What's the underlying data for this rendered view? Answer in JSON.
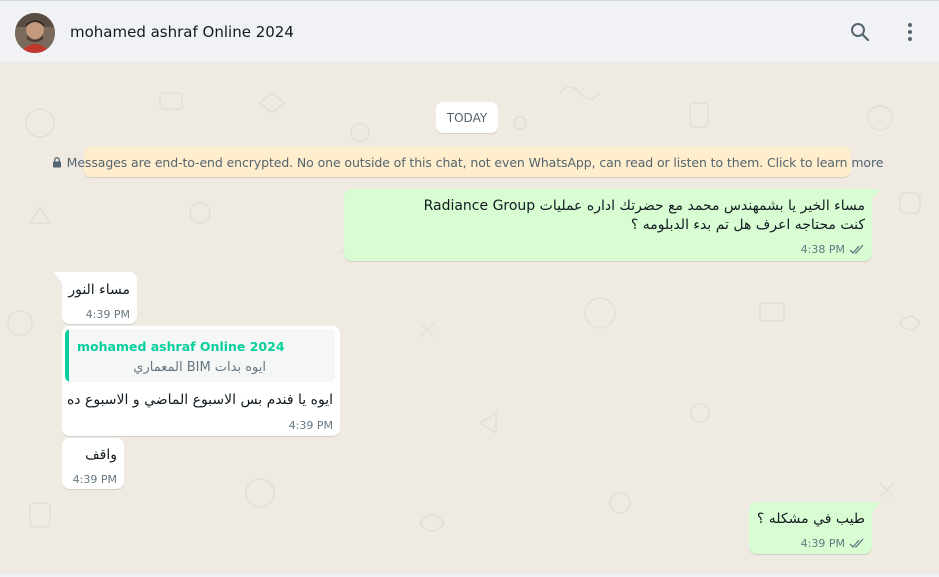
{
  "header": {
    "contact_name": "mohamed ashraf Online 2024",
    "search_icon": "search-icon",
    "menu_icon": "more-vertical-icon"
  },
  "date_chip": "TODAY",
  "encryption_notice": {
    "text": "Messages are end-to-end encrypted. No one outside of this chat, not even WhatsApp, can read or listen to them. Click to learn more",
    "icon": "lock-icon"
  },
  "messages": [
    {
      "direction": "outgoing",
      "lines": [
        "مساء الخير يا بشمهندس محمد مع حضرتك اداره عمليات Radiance Group",
        "كنت محتاجه اعرف هل تم بدء الدبلومه ؟"
      ],
      "time": "4:38 PM",
      "status": "read"
    },
    {
      "direction": "incoming",
      "lines": [
        "مساء النور"
      ],
      "time": "4:39 PM"
    },
    {
      "direction": "incoming",
      "quote": {
        "author": "mohamed ashraf Online 2024",
        "text": "ايوه بدات BIM  المعماري"
      },
      "lines": [
        "ايوه يا فندم بس الاسبوع الماضي و الاسبوع ده"
      ],
      "time": "4:39 PM"
    },
    {
      "direction": "incoming",
      "lines": [
        "واقف"
      ],
      "time": "4:39 PM"
    },
    {
      "direction": "outgoing",
      "lines": [
        "طيب في مشكله ؟"
      ],
      "time": "4:39 PM",
      "status": "read"
    }
  ],
  "colors": {
    "wallpaper": "#efeae2",
    "outgoing_bubble": "#d9fdd3",
    "incoming_bubble": "#ffffff",
    "quote_accent": "#06cf9c",
    "notice_bg": "#ffeecd",
    "read_ticks": "#667781"
  }
}
